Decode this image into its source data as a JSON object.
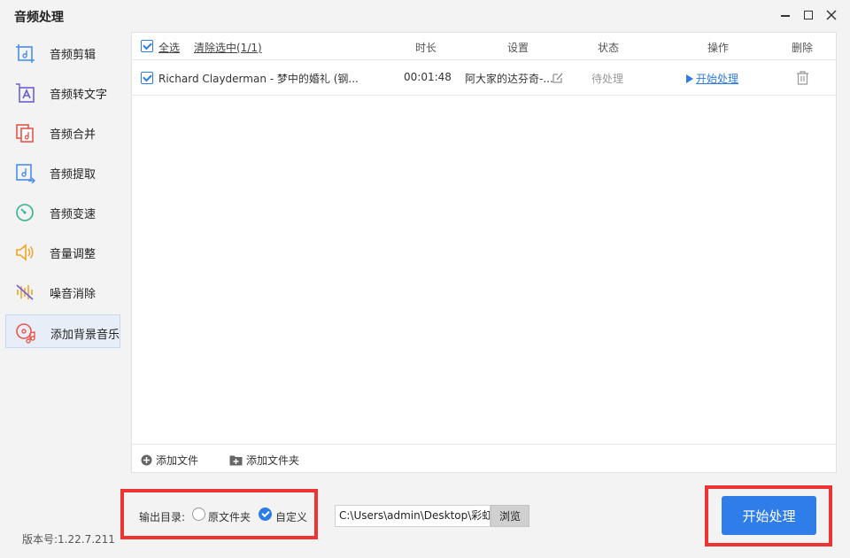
{
  "window": {
    "title": "音频处理"
  },
  "sidebar": {
    "items": [
      {
        "label": "音频剪辑",
        "icon": "audio-cut-icon"
      },
      {
        "label": "音频转文字",
        "icon": "audio-to-text-icon"
      },
      {
        "label": "音频合并",
        "icon": "audio-merge-icon"
      },
      {
        "label": "音频提取",
        "icon": "audio-extract-icon"
      },
      {
        "label": "音频变速",
        "icon": "audio-speed-icon"
      },
      {
        "label": "音量调整",
        "icon": "volume-icon"
      },
      {
        "label": "噪音消除",
        "icon": "noise-remove-icon"
      },
      {
        "label": "添加背景音乐",
        "icon": "background-music-icon"
      }
    ],
    "active_index": 7
  },
  "version": "版本号:1.22.7.211",
  "table": {
    "select_all": "全选",
    "clear_selected": "清除选中(1/1)",
    "columns": {
      "duration": "时长",
      "settings": "设置",
      "status": "状态",
      "action": "操作",
      "delete": "删除"
    },
    "rows": [
      {
        "checked": true,
        "name": "Richard Clayderman - 梦中的婚礼 (钢...",
        "duration": "00:01:48",
        "settings": "阿大家的达芬奇-...",
        "status": "待处理",
        "action": "开始处理"
      }
    ],
    "add_file": "添加文件",
    "add_folder": "添加文件夹"
  },
  "output": {
    "label": "输出目录:",
    "option_original": "原文件夹",
    "option_custom": "自定义",
    "selected": "custom",
    "path": "C:\\Users\\admin\\Desktop\\彩虹",
    "browse": "浏览"
  },
  "start_button": "开始处理",
  "colors": {
    "accent": "#2f7de8",
    "highlight": "#ee3333"
  }
}
